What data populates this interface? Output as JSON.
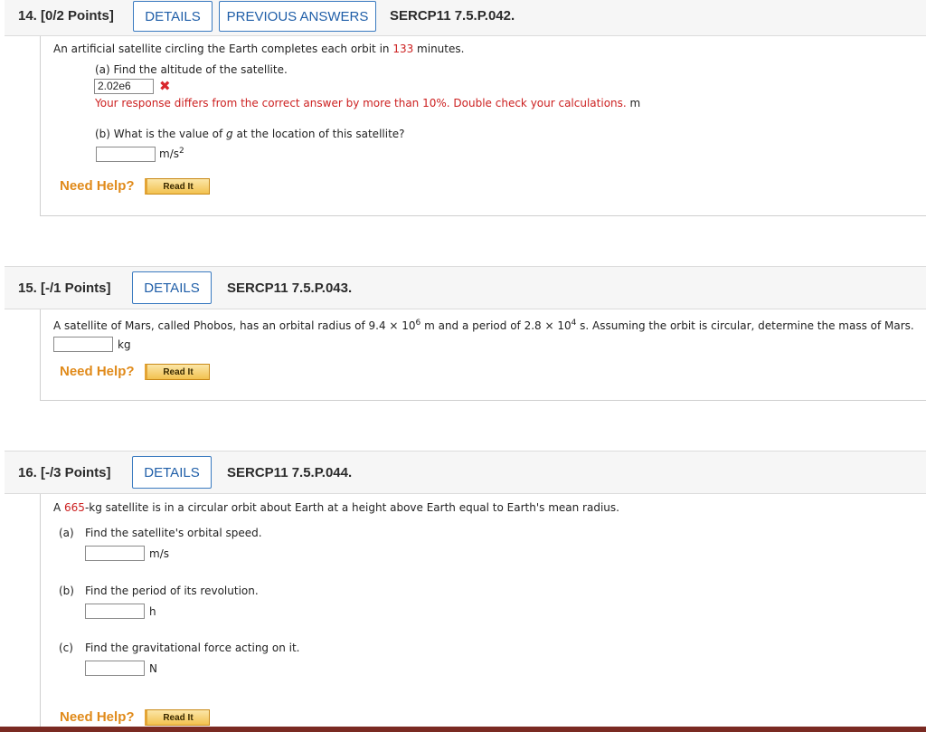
{
  "q14": {
    "number": "14. [0/2 Points]",
    "details_label": "DETAILS",
    "previous_label": "PREVIOUS ANSWERS",
    "id": "SERCP11 7.5.P.042.",
    "prompt_pre": "An artificial satellite circling the Earth completes each orbit in ",
    "prompt_value": "133",
    "prompt_post": " minutes.",
    "part_a": "(a) Find the altitude of the satellite.",
    "part_a_value": "2.02e6",
    "part_a_feedback": "Your response differs from the correct answer by more than 10%. Double check your calculations.",
    "part_a_unit": "m",
    "part_b_pre": "(b) What is the value of ",
    "part_b_var": "g",
    "part_b_post": " at the location of this satellite?",
    "part_b_unit": "m/s",
    "part_b_unit_sup": "2",
    "need_help": "Need Help?",
    "read_it": "Read It"
  },
  "q15": {
    "number": "15. [-/1 Points]",
    "details_label": "DETAILS",
    "id": "SERCP11 7.5.P.043.",
    "prompt_a": "A satellite of Mars, called Phobos, has an orbital radius of 9.4 × 10",
    "prompt_a_sup": "6",
    "prompt_b": " m and a period of 2.8 × 10",
    "prompt_b_sup": "4",
    "prompt_c": " s. Assuming the orbit is circular, determine the mass of Mars.",
    "unit": "kg",
    "need_help": "Need Help?",
    "read_it": "Read It"
  },
  "q16": {
    "number": "16. [-/3 Points]",
    "details_label": "DETAILS",
    "id": "SERCP11 7.5.P.044.",
    "prompt_pre": "A ",
    "prompt_value": "665",
    "prompt_post": "-kg satellite is in a circular orbit about Earth at a height above Earth equal to Earth's mean radius.",
    "part_a_label": "(a)",
    "part_a": "Find the satellite's orbital speed.",
    "part_a_unit": "m/s",
    "part_b_label": "(b)",
    "part_b": "Find the period of its revolution.",
    "part_b_unit": "h",
    "part_c_label": "(c)",
    "part_c": "Find the gravitational force acting on it.",
    "part_c_unit": "N",
    "need_help": "Need Help?",
    "read_it": "Read It"
  },
  "colors": {
    "accent_blue": "#1f5ea8",
    "error_red": "#cc1f1f",
    "help_orange": "#e08a1a"
  }
}
